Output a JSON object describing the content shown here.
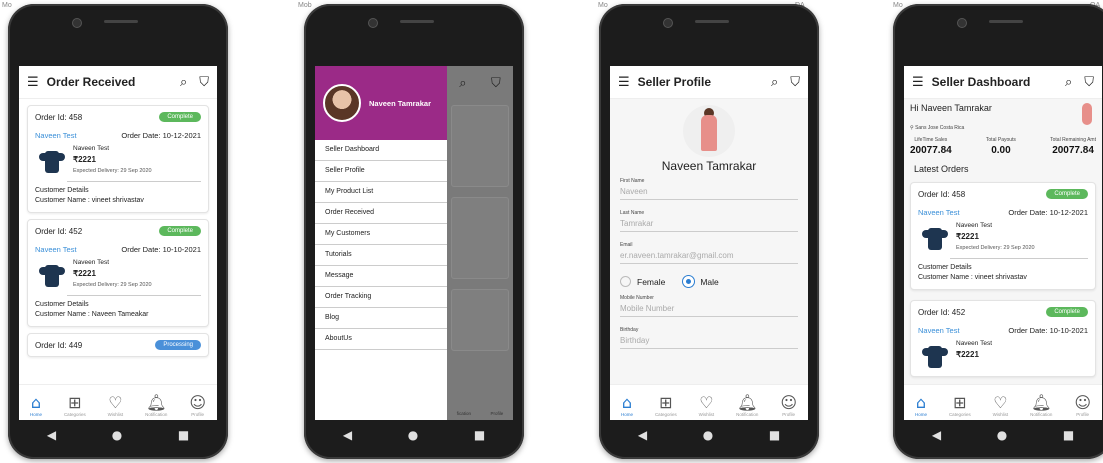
{
  "fragments": [
    "Mo",
    "Mob",
    "Mo",
    "DA",
    "Mo",
    "OA"
  ],
  "phone1": {
    "title": "Order Received",
    "orders": [
      {
        "id_label": "Order Id: 458",
        "status": "Complete",
        "customer": "Naveen Test",
        "date_label": "Order Date: 10-12-2021",
        "product_name": "Naveen Test",
        "price": "₹2221",
        "delivery": "Expected Delivery: 29 Sep 2020",
        "details_label": "Customer Details",
        "customer_name": "Customer Name : vineet shrivastav"
      },
      {
        "id_label": "Order Id: 452",
        "status": "Complete",
        "customer": "Naveen Test",
        "date_label": "Order Date: 10-10-2021",
        "product_name": "Naveen Test",
        "price": "₹2221",
        "delivery": "Expected Delivery: 29 Sep 2020",
        "details_label": "Customer Details",
        "customer_name": "Customer Name : Naveen Tameakar"
      }
    ],
    "order3": {
      "id_label": "Order Id: 449",
      "status": "Processing"
    }
  },
  "tabs": [
    "Home",
    "Categories",
    "Wishlist",
    "Notification",
    "Profile"
  ],
  "phone2": {
    "user_name": "Naveen Tamrakar",
    "menu": [
      "Seller Dashboard",
      "Seller Profile",
      "My Product List",
      "Order Received",
      "My Customers",
      "Tutorials",
      "Message",
      "Order Tracking",
      "Blog",
      "AboutUs"
    ],
    "tab_fragments": [
      "fication",
      "Profile"
    ]
  },
  "phone3": {
    "title": "Seller Profile",
    "name": "Naveen Tamrakar",
    "fields": [
      {
        "label": "First Name",
        "value": "Naveen"
      },
      {
        "label": "Last Name",
        "value": "Tamrakar"
      },
      {
        "label": "Email",
        "value": "er.naveen.tamrakar@gmail.com"
      }
    ],
    "gender": {
      "female": "Female",
      "male": "Male",
      "selected": "Male"
    },
    "fields2": [
      {
        "label": "Mobile Number",
        "value": "Mobile Number"
      },
      {
        "label": "Birthday",
        "value": "Birthday"
      }
    ]
  },
  "phone4": {
    "title": "Seller Dashboard",
    "greeting": "Hi Naveen Tamrakar",
    "location": "Sans Jose Costa Rica",
    "stats": [
      {
        "label": "LifeTime Sales",
        "value": "20077.84"
      },
      {
        "label": "Total Payouts",
        "value": "0.00"
      },
      {
        "label": "Total Remaining Amt",
        "value": "20077.84"
      }
    ],
    "latest": "Latest Orders",
    "order": {
      "id_label": "Order Id: 458",
      "status": "Complete",
      "customer": "Naveen Test",
      "date_label": "Order Date: 10-12-2021",
      "product_name": "Naveen Test",
      "price": "₹2221",
      "delivery": "Expected Delivery: 29 Sep 2020",
      "details_label": "Customer Details",
      "customer_name": "Customer Name : vineet shrivastav"
    },
    "order2": {
      "id_label": "Order Id: 452",
      "status": "Complete",
      "customer": "Naveen Test",
      "date_label": "Order Date: 10-10-2021",
      "product_name": "Naveen Test",
      "price": "₹2221"
    }
  },
  "icons": {
    "menu": "hamburger-icon",
    "search": "search-icon",
    "bag": "bag-icon",
    "back": "back-icon",
    "home": "home-icon",
    "recent": "recent-icon"
  }
}
